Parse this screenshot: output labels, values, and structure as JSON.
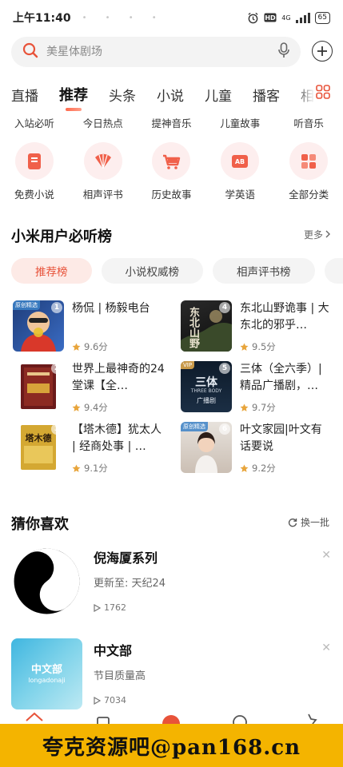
{
  "status_bar": {
    "time": "上午11:40",
    "dots": "• • • •",
    "network": "4G",
    "battery": "65"
  },
  "search": {
    "placeholder": "美星体剧场"
  },
  "tabs": [
    "直播",
    "推荐",
    "头条",
    "小说",
    "儿童",
    "播客",
    "相"
  ],
  "active_tab": "推荐",
  "quick_links": [
    "入站必听",
    "今日热点",
    "提神音乐",
    "儿童故事",
    "听音乐"
  ],
  "categories": [
    {
      "label": "免费小说",
      "icon": "book-icon"
    },
    {
      "label": "相声评书",
      "icon": "fan-icon"
    },
    {
      "label": "历史故事",
      "icon": "cart-icon"
    },
    {
      "label": "学英语",
      "icon": "ab-card-icon"
    },
    {
      "label": "全部分类",
      "icon": "grid-icon"
    }
  ],
  "ranking": {
    "title": "小米用户必听榜",
    "more": "更多",
    "tabs": [
      "推荐榜",
      "小说权威榜",
      "相声评书榜",
      "广"
    ],
    "items": [
      {
        "rank": "1",
        "tag": "原创精选",
        "title": "杨侃 | 杨毅电台",
        "score": "9.6分"
      },
      {
        "rank": "4",
        "tag": "",
        "title": "东北山野诡事 | 大东北的邪乎…",
        "score": "9.5分"
      },
      {
        "rank": "2",
        "tag": "",
        "title": "世界上最神奇的24堂课【全…",
        "score": "9.4分"
      },
      {
        "rank": "5",
        "tag": "VIP",
        "title": "三体（全六季）| 精品广播剧，…",
        "score": "9.7分"
      },
      {
        "rank": "3",
        "tag": "",
        "title": "【塔木德】犹太人 | 经商处事 | …",
        "score": "9.1分"
      },
      {
        "rank": "6",
        "tag": "原创精选",
        "title": "叶文家园|叶文有话要说",
        "score": "9.2分"
      }
    ]
  },
  "guess": {
    "title": "猜你喜欢",
    "refresh": "换一批",
    "items": [
      {
        "title": "倪海厦系列",
        "subtitle": "更新至: 天纪24",
        "plays": "1762"
      },
      {
        "title": "中文部",
        "subtitle": "节目质量高",
        "plays": "7034"
      }
    ]
  },
  "covers": {
    "cover2_text": "东北山野",
    "cover4_text": "三体",
    "cover4_sub": "THREE BODY",
    "cover4_sub2": "广播剧",
    "cover5_text": "塔木德",
    "rec2_text": "中文部",
    "rec2_sub": "longadonaji"
  },
  "watermark": "夸克资源吧@pan168.cn",
  "colors": {
    "accent": "#e8533a",
    "accent_light": "#fdeae6",
    "star": "#e8a53c",
    "watermark_bg": "#f4b400"
  }
}
